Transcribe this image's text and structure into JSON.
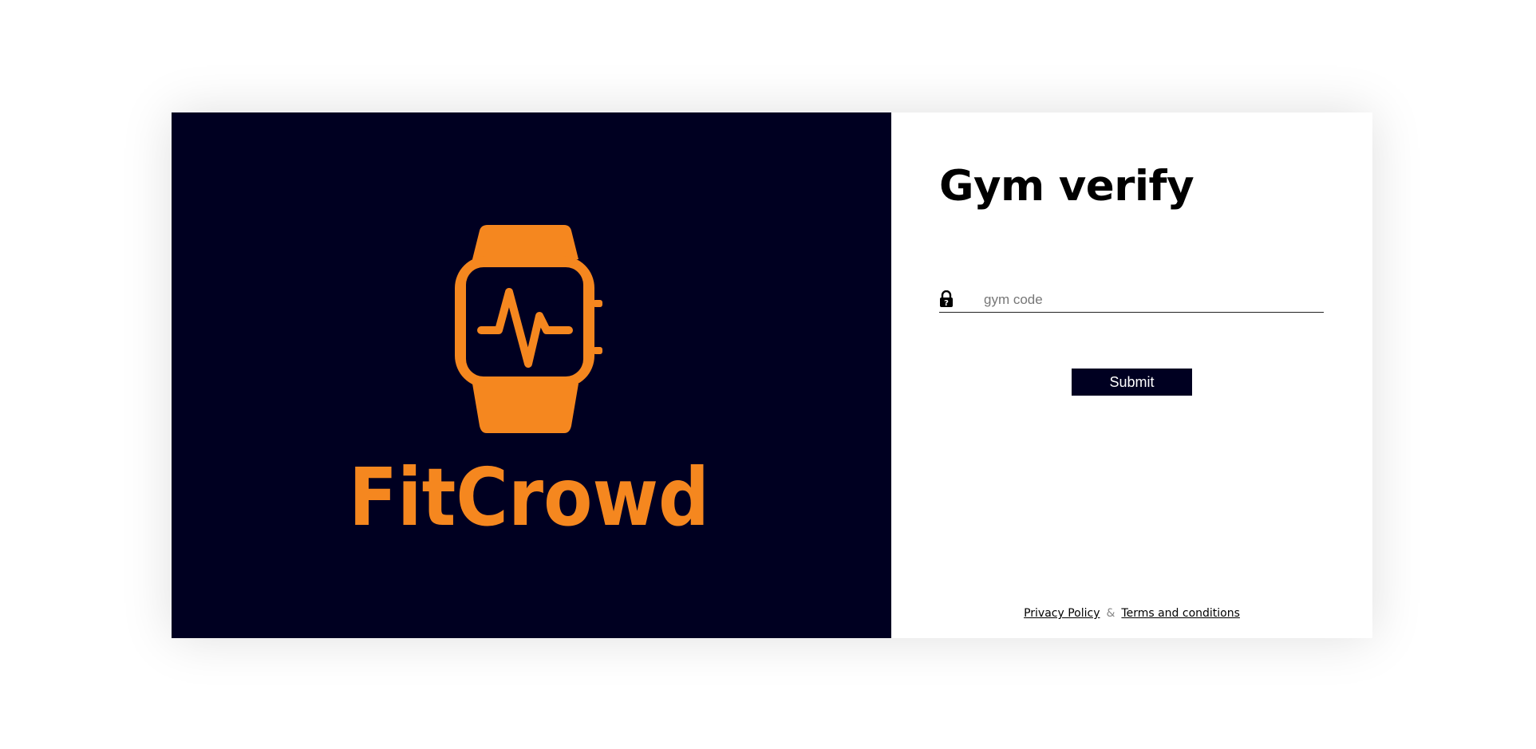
{
  "brand": {
    "name": "FitCrowd",
    "logo_icon": "smartwatch-heartbeat-icon",
    "accent_color": "#F5871F",
    "panel_color": "#000021"
  },
  "form": {
    "title": "Gym verify",
    "code_field": {
      "icon": "lock-icon",
      "placeholder": "gym code",
      "value": ""
    },
    "submit_label": "Submit"
  },
  "footer": {
    "privacy_label": "Privacy Policy",
    "separator": "&",
    "terms_label": "Terms and conditions"
  }
}
